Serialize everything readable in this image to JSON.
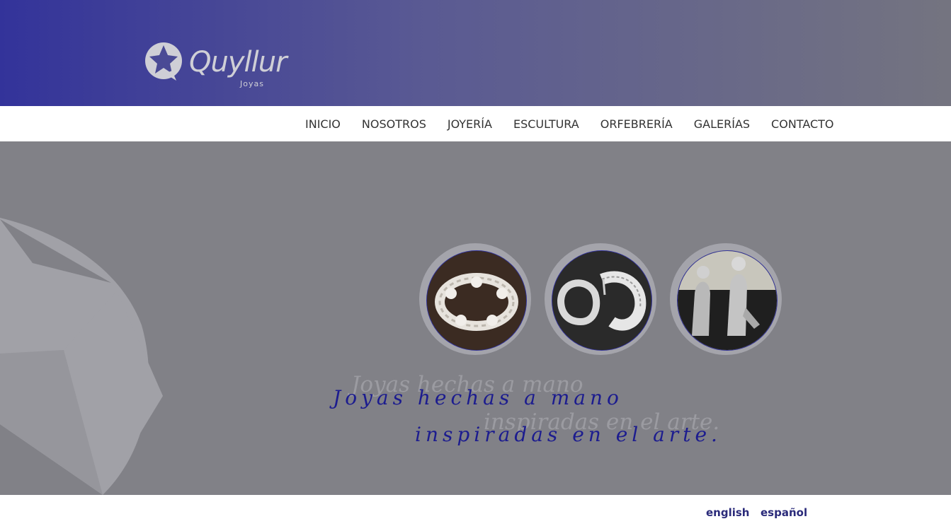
{
  "brand": {
    "name": "Quyllur",
    "subtitle": "Joyas"
  },
  "nav": {
    "items": [
      {
        "label": "INICIO"
      },
      {
        "label": "NOSOTROS"
      },
      {
        "label": "JOYERÍA"
      },
      {
        "label": "ESCULTURA"
      },
      {
        "label": "ORFEBRERÍA"
      },
      {
        "label": "GALERÍAS"
      },
      {
        "label": "CONTACTO"
      }
    ]
  },
  "hero": {
    "tagline_line1": "Joyas hechas a mano",
    "tagline_line2": "inspiradas en el arte.",
    "gallery": [
      {
        "icon": "filigree-ring-photo"
      },
      {
        "icon": "filigree-earrings-photo"
      },
      {
        "icon": "silver-sculpture-photo"
      }
    ]
  },
  "languages": {
    "english": "english",
    "spanish": "español"
  },
  "colors": {
    "header_start": "#33339a",
    "header_end": "#747480",
    "hero_bg": "#818187",
    "accent": "#1c1c8f",
    "lang_link": "#2a2a7a"
  }
}
